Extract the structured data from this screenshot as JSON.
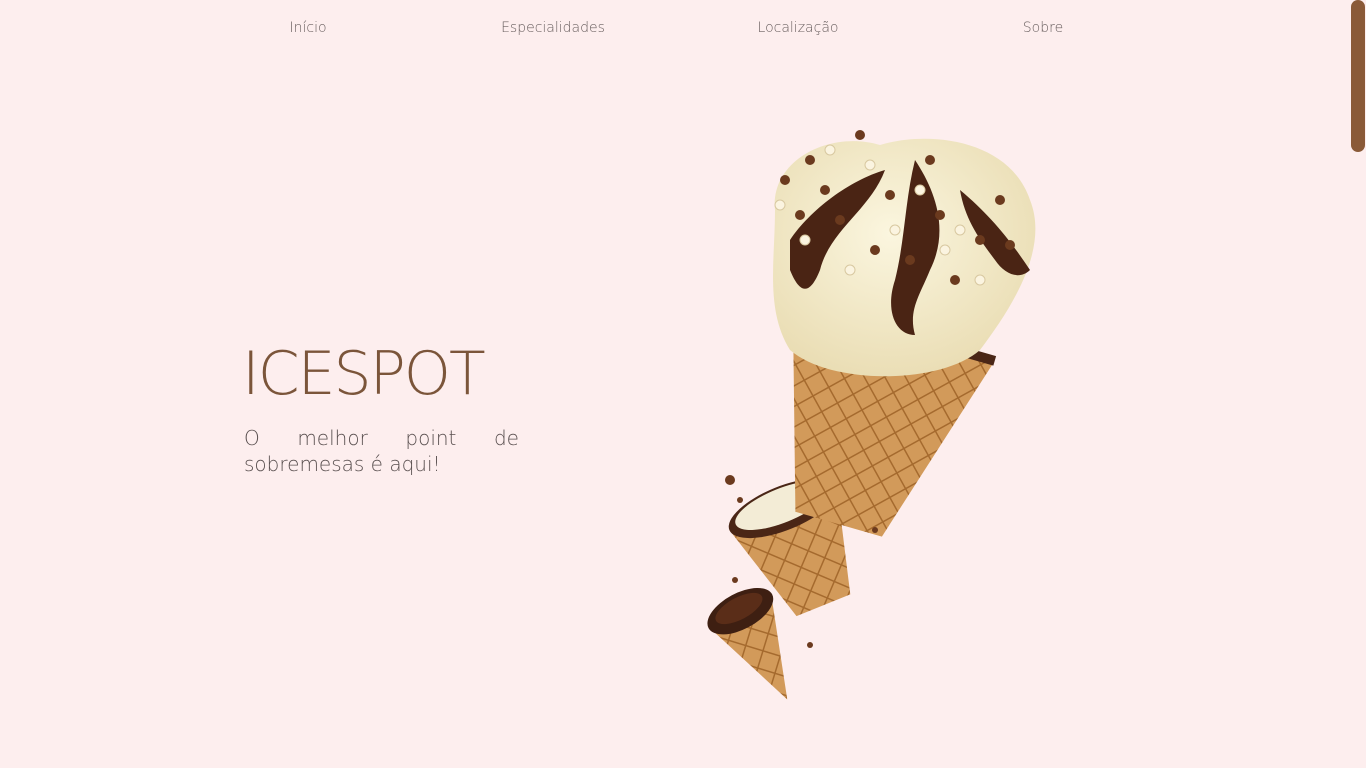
{
  "nav": {
    "items": [
      {
        "label": "Início"
      },
      {
        "label": "Especialidades"
      },
      {
        "label": "Localização"
      },
      {
        "label": "Sobre"
      }
    ]
  },
  "hero": {
    "title": "ICESPOT",
    "subtitle": "O melhor point de sobremesas é aqui!",
    "image": "ice-cream-cone-with-chocolate-sprinkles"
  },
  "colors": {
    "background": "#fdeeee",
    "brand": "#7b553a",
    "scrollbar": "#8a5a38"
  }
}
